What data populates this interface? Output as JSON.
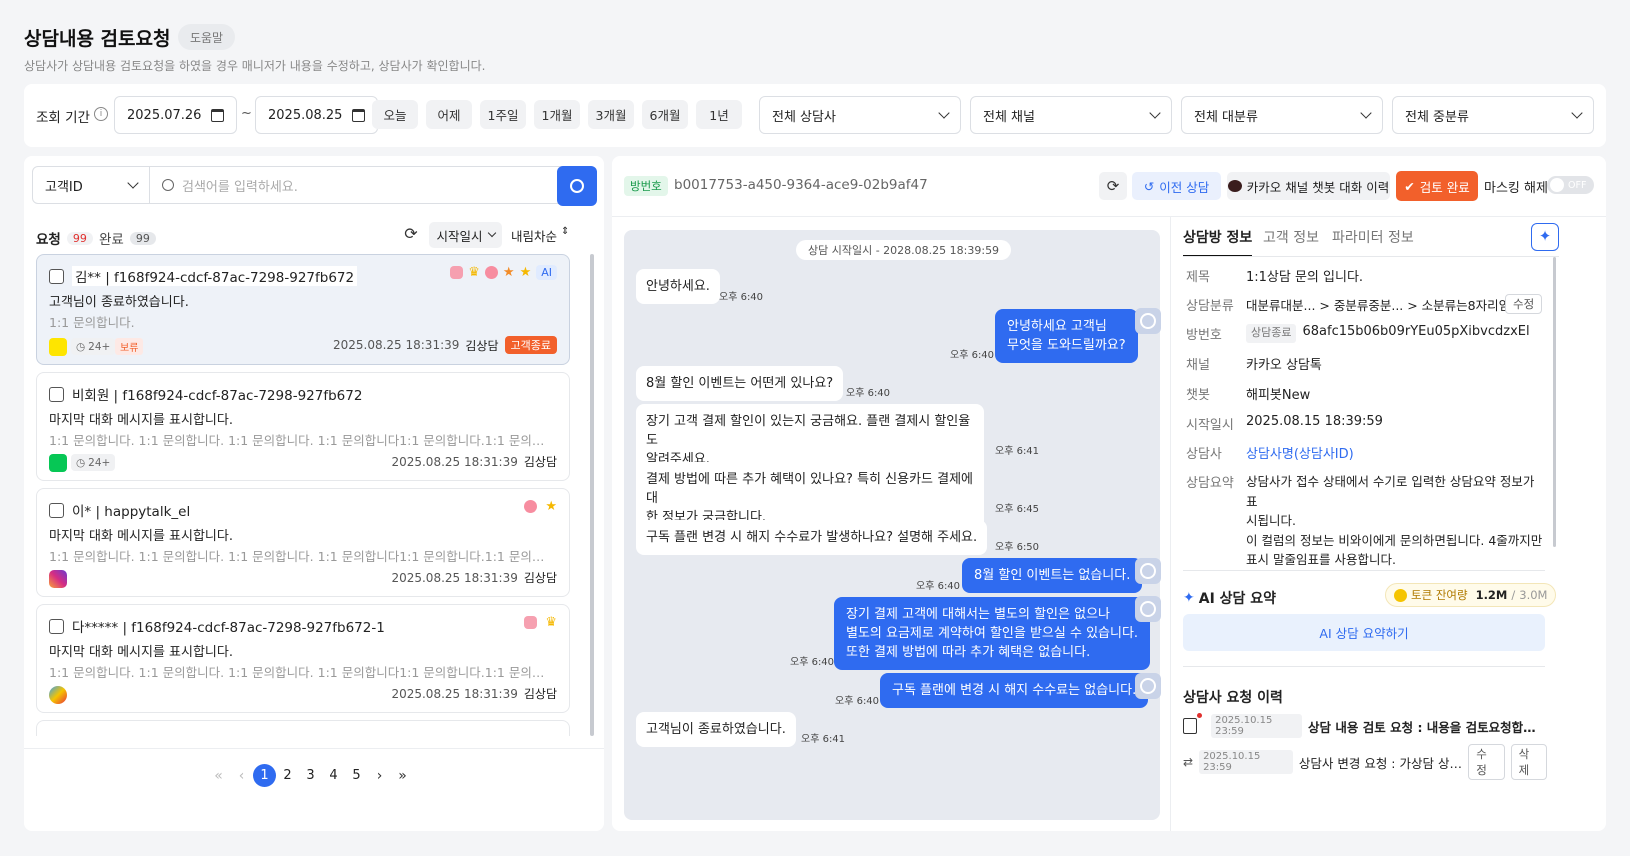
{
  "header": {
    "title": "상담내용 검토요청",
    "help": "도움말",
    "desc": "상담사가 상담내용 검토요청을 하였을 경우 매니저가 내용을 수정하고, 상담사가 확인합니다."
  },
  "filter": {
    "period_label": "조회 기간",
    "date_from": "2025.07.26",
    "tilde": "~",
    "date_to": "2025.08.25",
    "quick": [
      "오늘",
      "어제",
      "1주일",
      "1개월",
      "3개월",
      "6개월",
      "1년"
    ],
    "selects": [
      "전체 상담사",
      "전체 채널",
      "전체 대분류",
      "전체 중분류"
    ]
  },
  "left": {
    "search_type": "고객ID",
    "search_placeholder": "검색어를 입력하세요.",
    "tab_req": "요청",
    "tab_req_count": "99",
    "tab_done": "완료",
    "tab_done_count": "99",
    "sort_field": "시작일시",
    "sort_dir": "내림차순",
    "items": [
      {
        "title": "김** | f168f924-cdcf-87ac-7298-927fb672",
        "msg": "고객님이 종료하였습니다.",
        "sub": "1:1 문의합니다.",
        "time": "24+",
        "tag": "보류",
        "date": "2025.08.25 18:31:39",
        "agent": "김상담",
        "status": "고객종료",
        "ai": "AI"
      },
      {
        "title": "비회원 | f168f924-cdcf-87ac-7298-927fb672",
        "msg": "마지막 대화 메시지를 표시합니다.",
        "sub": "1:1 문의합니다. 1:1 문의합니다. 1:1 문의합니다. 1:1 문의합니다1:1 문의합니다.1:1 문의합니다.",
        "time": "24+",
        "date": "2025.08.25 18:31:39",
        "agent": "김상담"
      },
      {
        "title": "이* | happytalk_el",
        "msg": "마지막 대화 메시지를 표시합니다.",
        "sub": "1:1 문의합니다. 1:1 문의합니다. 1:1 문의합니다. 1:1 문의합니다1:1 문의합니다.1:1 문의합니다.",
        "date": "2025.08.25 18:31:39",
        "agent": "김상담"
      },
      {
        "title": "다***** | f168f924-cdcf-87ac-7298-927fb672-1",
        "msg": "마지막 대화 메시지를 표시합니다.",
        "sub": "1:1 문의합니다. 1:1 문의합니다. 1:1 문의합니다. 1:1 문의합니다1:1 문의합니다.1:1 문의합니다.",
        "date": "2025.08.25 18:31:39",
        "agent": "김상담"
      }
    ],
    "pages": [
      "1",
      "2",
      "3",
      "4",
      "5"
    ]
  },
  "chat": {
    "room_label": "방번호",
    "room_id": "b0017753-a450-9364-ace9-02b9af47",
    "prev_btn": "이전 상담",
    "kakao_btn": "카카오 채널 챗봇 대화 이력",
    "review_btn": "검토 완료",
    "mask_label": "마스킹 해제",
    "toggle": "OFF",
    "start_time": "상담 시작일시 - 2028.08.25 18:39:59",
    "messages": [
      {
        "text": "안녕하세요.",
        "time": "오후 6:40"
      },
      {
        "text": "안녕하세요 고객님\n무엇을 도와드릴까요?",
        "time": "오후 6:40"
      },
      {
        "text": "8월 할인 이벤트는 어떤게 있나요?",
        "time": "오후 6:40"
      },
      {
        "text": "장기 고객 결제 할인이 있는지 궁금해요. 플랜 결제시 할인율도\n알려주세요.",
        "time": "오후 6:41"
      },
      {
        "text": "결제 방법에 따른 추가 혜택이 있나요? 특히 신용카드 결제에 대\n한 정보가 궁금합니다.",
        "time": "오후 6:45"
      },
      {
        "text": "구독 플랜 변경 시 해지 수수료가 발생하나요? 설명해 주세요.",
        "time": "오후 6:50"
      },
      {
        "text": "8월 할인 이벤트는 없습니다.",
        "time": "오후 6:40"
      },
      {
        "text": "장기 결제 고객에 대해서는 별도의 할인은 없으나\n별도의 요금제로 계약하여 할인을 받으실 수 있습니다.\n또한 결제 방법에 따라 추가 혜택은 없습니다.",
        "time": "오후 6:40"
      },
      {
        "text": "구독 플랜에 변경 시 해지 수수료는 없습니다.",
        "time": "오후 6:40"
      },
      {
        "text": "고객님이 종료하였습니다.",
        "time": "오후 6:41"
      }
    ]
  },
  "info": {
    "tabs": [
      "상담방 정보",
      "고객 정보",
      "파라미터 정보"
    ],
    "rows": [
      {
        "k": "제목",
        "v": "1:1상담 문의 입니다."
      },
      {
        "k": "상담분류",
        "v": "대분류대분... > 중분류중분... > 소분류는8자리임",
        "btn": "수정"
      },
      {
        "k": "방번호",
        "badge": "상담종료",
        "v": "68afc15b06b09rYEu05pXibvcdzxEl"
      },
      {
        "k": "채널",
        "v": "카카오 상담톡"
      },
      {
        "k": "챗봇",
        "v": "해피봇New"
      },
      {
        "k": "시작일시",
        "v": "2025.08.15 18:39:59"
      },
      {
        "k": "상담사",
        "v": "상담사명(상담사ID)"
      },
      {
        "k": "상담요약",
        "v": "상담사가 접수 상태에서 수기로 입력한 상담요약 정보가 표\n시됩니다.\n이 컬럼의 정보는 비와이에게 문의하면됩니다. 4줄까지만\n표시 말줄임표를 사용합니다."
      }
    ],
    "ai_title": "AI 상담 요약",
    "token_label": "토큰 잔여량",
    "token_used": "1.2M",
    "token_sep": "/",
    "token_total": "3.0M",
    "ai_btn": "AI 상담 요약하기",
    "history_title": "상담사 요청 이력",
    "history": [
      {
        "date": "2025.10.15 23:59",
        "text": "상담 내용 검토 요청 : 내용을 검토요청합니다...."
      },
      {
        "date": "2025.10.15 23:59",
        "text": "상담사 변경 요청 : 가상담 상담...",
        "edit": "수정",
        "del": "삭제"
      }
    ]
  },
  "colors": {
    "accent": "#2f6bf0",
    "orange": "#f2602b",
    "kakao": "#fee500",
    "line": "#06c755"
  }
}
